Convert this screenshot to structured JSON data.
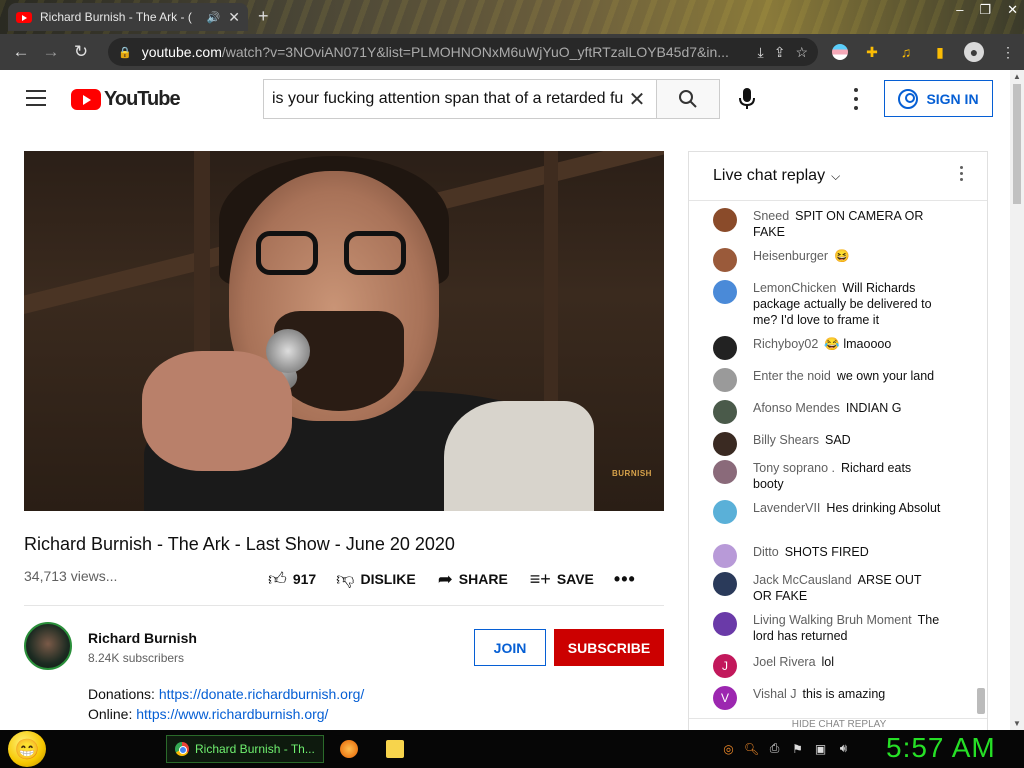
{
  "browser": {
    "tab_title": "Richard Burnish - The Ark - (",
    "url_main": "youtube.com",
    "url_rest": "/watch?v=3NOviAN071Y&list=PLMOHNONxM6uWjYuO_yftRTzalLOYB45d7&in..."
  },
  "header": {
    "logo_text": "YouTube",
    "search_query": "is your fucking attention span that of a retarded fu",
    "sign_in_label": "SIGN IN"
  },
  "video": {
    "watermark": "BURNISH",
    "title": "Richard Burnish - The Ark - Last Show - June 20 2020",
    "views": "34,713 views...",
    "like_count": "917",
    "dislike_label": "DISLIKE",
    "share_label": "SHARE",
    "save_label": "SAVE"
  },
  "channel": {
    "name": "Richard Burnish",
    "subscribers": "8.24K subscribers",
    "join_label": "JOIN",
    "subscribe_label": "SUBSCRIBE"
  },
  "description": {
    "donations_label": "Donations:",
    "donations_url": "https://donate.richardburnish.org/",
    "online_label": "Online:",
    "online_url": "https://www.richardburnish.org/"
  },
  "chat": {
    "header": "Live chat replay",
    "bottom_hint": "HIDE CHAT REPLAY",
    "messages": [
      {
        "author": "Sneed",
        "text": "SPIT ON CAMERA OR FAKE",
        "avatar_color": "#8a4b2a",
        "initial": ""
      },
      {
        "author": "Heisenburger",
        "text": "😆",
        "avatar_color": "#9a5a3a",
        "initial": ""
      },
      {
        "author": "LemonChicken",
        "text": "Will Richards package actually be delivered to me? I'd love to frame it",
        "avatar_color": "#4a8ad8",
        "initial": ""
      },
      {
        "author": "Richyboy02",
        "text": "😂 lmaoooo",
        "avatar_color": "#222222",
        "initial": ""
      },
      {
        "author": "Enter the noid",
        "text": "we own your land",
        "avatar_color": "#9a9a9a",
        "initial": ""
      },
      {
        "author": "Afonso Mendes",
        "text": "INDIAN G",
        "avatar_color": "#4a5a4a",
        "initial": ""
      },
      {
        "author": "Billy Shears",
        "text": "SAD",
        "avatar_color": "#3a2a22",
        "initial": ""
      },
      {
        "author": "Tony soprano .",
        "text": "Richard eats booty",
        "avatar_color": "#8a6a7a",
        "initial": ""
      },
      {
        "author": "LavenderVII",
        "text": "Hes drinking Absolut",
        "avatar_color": "#5ab0d8",
        "initial": ""
      },
      {
        "author": "Ditto",
        "text": "SHOTS FIRED",
        "avatar_color": "#b89ad8",
        "initial": ""
      },
      {
        "author": "Jack McCausland",
        "text": "ARSE OUT OR FAKE",
        "avatar_color": "#2a3a5a",
        "initial": ""
      },
      {
        "author": "Living Walking Bruh Moment",
        "text": "The lord has returned",
        "avatar_color": "#6a3aa8",
        "initial": ""
      },
      {
        "author": "Joel Rivera",
        "text": "lol",
        "avatar_color": "#c2185b",
        "initial": "J"
      },
      {
        "author": "Vishal J",
        "text": "this is amazing",
        "avatar_color": "#9c27b0",
        "initial": "V"
      }
    ]
  },
  "taskbar": {
    "task_label": "Richard Burnish - Th...",
    "clock": "5:57 AM"
  },
  "colors": {
    "youtube_red": "#ff0000",
    "link_blue": "#065fd4",
    "subscribe_red": "#cc0000",
    "clock_green": "#26e026"
  }
}
